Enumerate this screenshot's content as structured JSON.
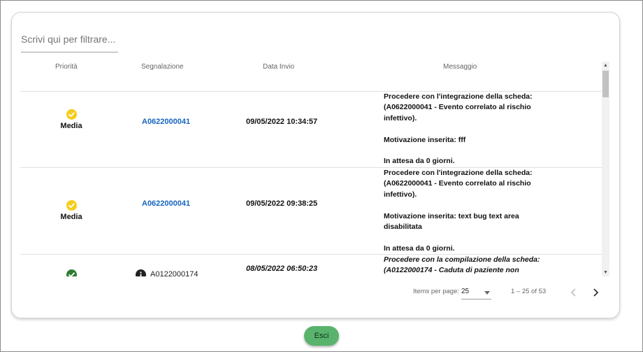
{
  "filter": {
    "placeholder": "Scrivi qui per filtrare..."
  },
  "table": {
    "headers": [
      "Priorità",
      "Segnalazione",
      "Data Invio",
      "Messaggio"
    ],
    "rows": [
      {
        "priority": "Media",
        "priority_icon": "check-circle-yellow",
        "code": "A0622000041",
        "date": "09/05/2022 10:34:57",
        "msg_lines": [
          "Procedere con l'integrazione della scheda:",
          "(A0622000041 - Evento correlato al rischio",
          "infettivo).",
          "",
          "Motivazione inserita: fff",
          "",
          "In attesa da 0 giorni."
        ]
      },
      {
        "priority": "Media",
        "priority_icon": "check-circle-yellow",
        "code": "A0622000041",
        "date": "09/05/2022 09:38:25",
        "msg_lines": [
          "Procedere con l'integrazione della scheda:",
          "(A0622000041 - Evento correlato al rischio",
          "infettivo).",
          "",
          "Motivazione inserita: text bug text area",
          "disabilitata",
          "",
          "In attesa da 0 giorni."
        ]
      },
      {
        "priority": "",
        "priority_icon": "check-circle-green",
        "code_icon": "info-icon",
        "code": "A0122000174",
        "date": "08/05/2022 06:50:23",
        "msg_lines": [
          "Procedere con la compilazione della scheda:",
          "(A0122000174 - Caduta di paziente non"
        ]
      }
    ]
  },
  "paginator": {
    "items_per_page_label": "Items per page:",
    "page_size": "25",
    "range": "1 – 25 of 53"
  },
  "buttons": {
    "exit": "Esci"
  },
  "colors": {
    "yellow": "#f5cd1a",
    "green": "#2e7d32",
    "link": "#1565c0",
    "exit_button": "#59b36d"
  }
}
